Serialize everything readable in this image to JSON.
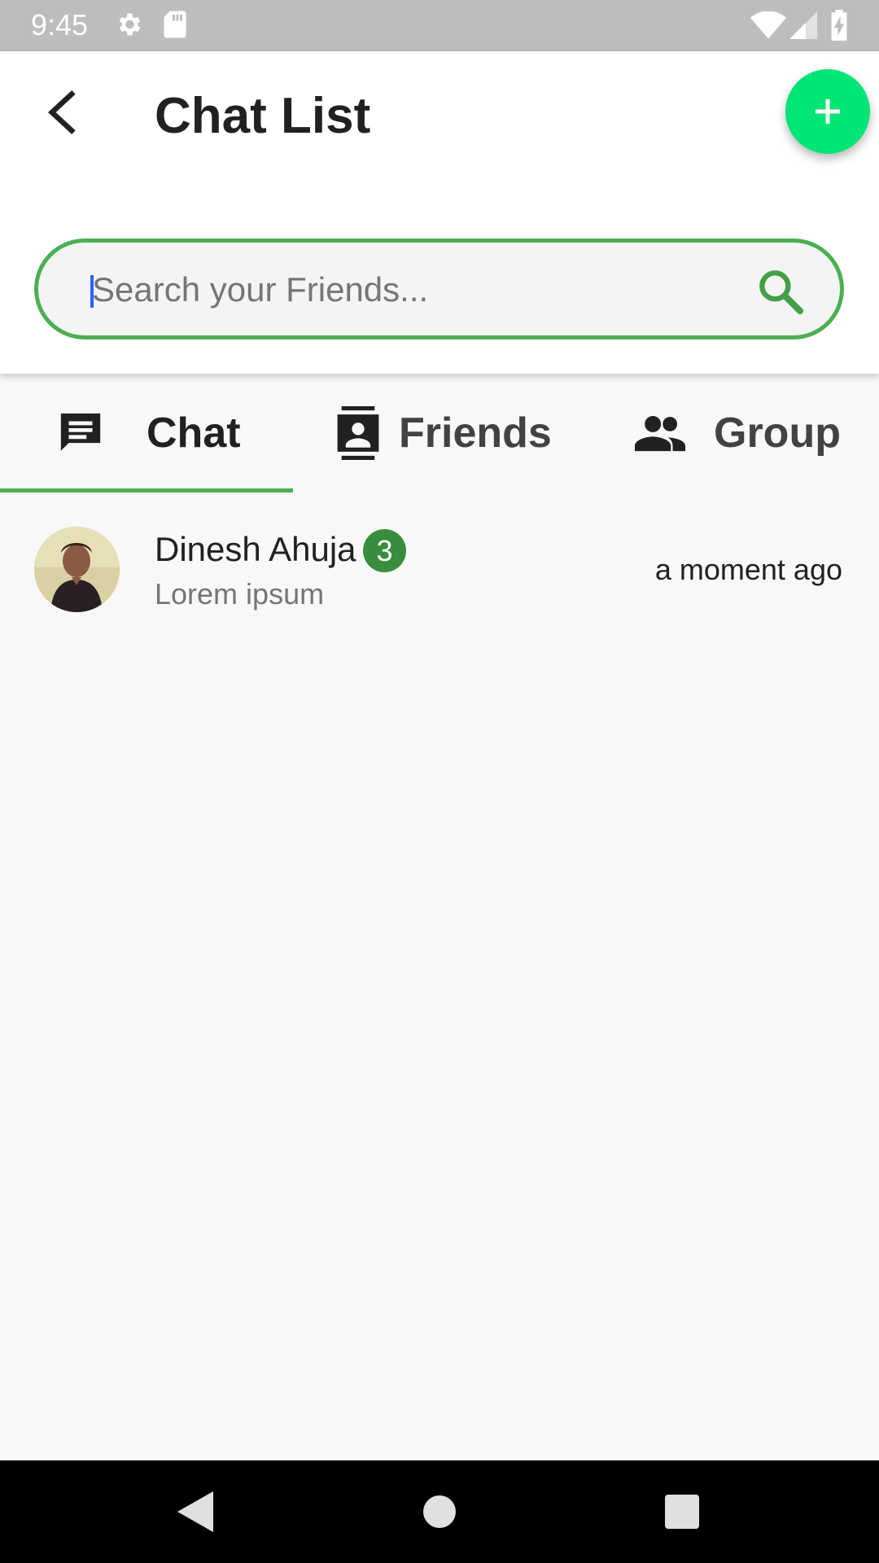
{
  "status_bar": {
    "time": "9:45",
    "icons": [
      "gear-icon",
      "sd-card-icon",
      "wifi-icon",
      "signal-icon",
      "battery-charging-icon"
    ]
  },
  "header": {
    "title": "Chat List",
    "back_icon": "arrow-back-icon",
    "fab_icon": "plus-icon"
  },
  "search": {
    "placeholder": "Search your Friends...",
    "value": "",
    "icon": "search-icon"
  },
  "tabs": [
    {
      "label": "Chat",
      "icon": "chat-icon",
      "selected": true
    },
    {
      "label": "Friends",
      "icon": "contact-card-icon",
      "selected": false
    },
    {
      "label": "Group",
      "icon": "group-icon",
      "selected": false
    }
  ],
  "chats": [
    {
      "name": "Dinesh Ahuja",
      "unread": "3",
      "preview": "Lorem ipsum",
      "time": "a moment ago"
    }
  ],
  "nav_bar": {
    "buttons": [
      "back-triangle-icon",
      "home-circle-icon",
      "recents-square-icon"
    ]
  },
  "colors": {
    "accent": "#4caf50",
    "fab": "#00e676",
    "badge": "#388e3c",
    "status_bar": "#bdbdbd"
  }
}
